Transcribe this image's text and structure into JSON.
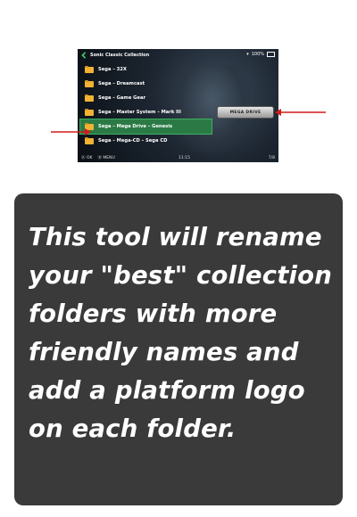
{
  "screenshot": {
    "title": "Sonic Classic Collection",
    "status_battery": "100%",
    "folders": [
      "Sega – 32X",
      "Sega – Dreamcast",
      "Sega – Game Gear",
      "Sega – Master System – Mark III",
      "Sega – Mega Drive – Genesis",
      "Sega – Mega-CD – Sega CD"
    ],
    "selected_index": 4,
    "logo_text": "MEGA DRIVE",
    "bottom": {
      "ok": "OK",
      "menu": "MENU",
      "clock": "11:15",
      "page": "7/8"
    }
  },
  "info": {
    "text": "This tool will rename your \"best\" collection folders with more friendly names and add a platform logo on each folder."
  },
  "colors": {
    "card": "#3a3a3a",
    "selection": "#2b7a45",
    "arrow": "#d11b1b"
  }
}
